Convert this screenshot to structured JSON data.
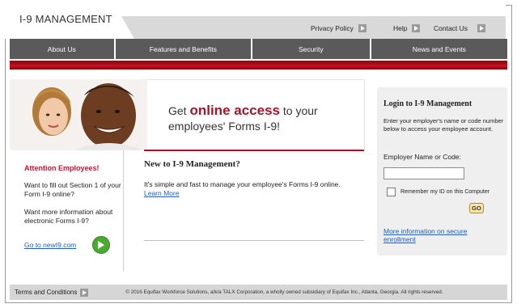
{
  "header": {
    "brand": "I-9 MANAGEMENT",
    "links": [
      {
        "label": "Privacy Policy"
      },
      {
        "label": "Help"
      },
      {
        "label": "Contact Us"
      }
    ]
  },
  "nav": {
    "items": [
      {
        "label": "About Us"
      },
      {
        "label": "Features and Benefits"
      },
      {
        "label": "Security"
      },
      {
        "label": "News and Events"
      }
    ]
  },
  "banner": {
    "pre": "Get ",
    "highlight": "online access",
    "post": " to your",
    "line2": "employees' Forms I-9!"
  },
  "left": {
    "attention": "Attention Employees!",
    "text1": "Want to fill out Section 1 of your Form I-9 online?",
    "text2": "Want more information about electronic Forms I-9?",
    "goto_link": "Go to newI9.com"
  },
  "main": {
    "title": "New to I-9 Management?",
    "text": "It's simple and fast to manage your employee's Forms I-9 online.",
    "learn_more": "Learn More"
  },
  "login": {
    "title": "Login to I-9 Management",
    "text": "Enter your employer's name or code number below to access your employee account.",
    "employer_label": "Employer Name or Code:",
    "employer_value": "",
    "remember_label": "Remember my ID on this Computer",
    "go_label": "GO",
    "more_info": "More information on secure enrollment"
  },
  "footer": {
    "terms": "Terms and Conditions",
    "copyright": "© 2016 Equifax Workforce Solutions, a/k/a TALX Corporation, a wholly owned subsidiary of Equifax Inc., Atlanta, Georgia. All rights reserved."
  },
  "colors": {
    "accent": "#a3152a",
    "nav_bg": "#5a5a5a",
    "link": "#1a5fb4"
  }
}
